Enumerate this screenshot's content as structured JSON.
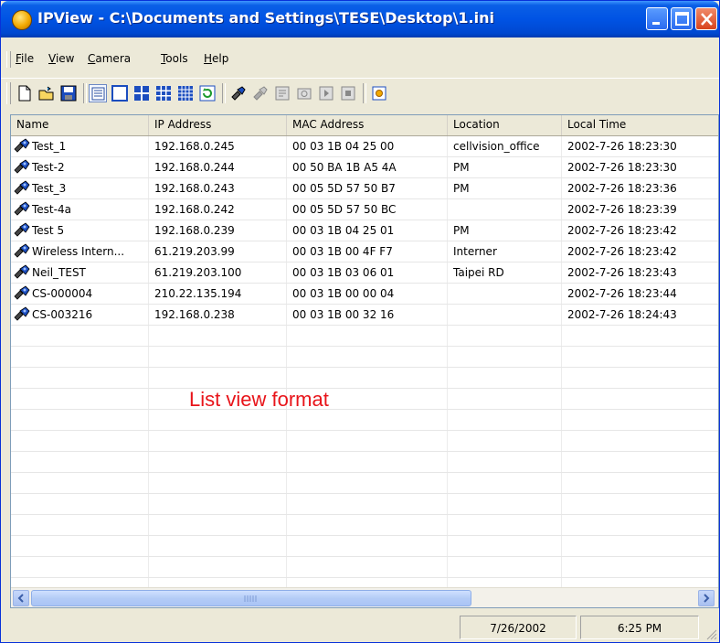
{
  "window": {
    "title": "IPView - C:\\Documents and Settings\\TESE\\Desktop\\1.ini",
    "title_color": "#0053e4"
  },
  "menu": {
    "items": [
      {
        "label": "File",
        "mnemonic": "F"
      },
      {
        "label": "View",
        "mnemonic": "V"
      },
      {
        "label": "Camera",
        "mnemonic": "C"
      },
      {
        "label": "Tools",
        "mnemonic": "T"
      },
      {
        "label": "Help",
        "mnemonic": "H"
      }
    ]
  },
  "toolbar": {
    "buttons": [
      "new-icon",
      "open-icon",
      "save-icon",
      "list-view-icon",
      "single-view-icon",
      "quad-view-icon",
      "nine-view-icon",
      "sixteen-view-icon",
      "refresh-icon",
      "connect-icon",
      "disconnect-icon",
      "properties-icon",
      "snapshot-icon",
      "play-icon",
      "stop-icon",
      "camera-settings-icon"
    ]
  },
  "list": {
    "columns": [
      "Name",
      "IP Address",
      "MAC Address",
      "Location",
      "Local Time"
    ],
    "rows": [
      {
        "name": "Test_1",
        "ip": "192.168.0.245",
        "mac": "00 03 1B 04 25 00",
        "location": "cellvision_office",
        "time": "2002-7-26  18:23:30"
      },
      {
        "name": "Test-2",
        "ip": "192.168.0.244",
        "mac": "00 50 BA 1B A5 4A",
        "location": "PM",
        "time": "2002-7-26  18:23:30"
      },
      {
        "name": "Test_3",
        "ip": "192.168.0.243",
        "mac": "00 05 5D 57 50 B7",
        "location": "PM",
        "time": "2002-7-26  18:23:36"
      },
      {
        "name": "Test-4a",
        "ip": "192.168.0.242",
        "mac": "00 05 5D 57 50 BC",
        "location": "",
        "time": "2002-7-26  18:23:39"
      },
      {
        "name": "Test 5",
        "ip": "192.168.0.239",
        "mac": "00 03 1B 04 25 01",
        "location": "PM",
        "time": "2002-7-26  18:23:42"
      },
      {
        "name": "Wireless Intern...",
        "ip": "61.219.203.99",
        "mac": "00 03 1B 00 4F F7",
        "location": "Interner",
        "time": "2002-7-26  18:23:42"
      },
      {
        "name": "Neil_TEST",
        "ip": "61.219.203.100",
        "mac": "00 03 1B 03 06 01",
        "location": "Taipei RD",
        "time": "2002-7-26  18:23:43"
      },
      {
        "name": "CS-000004",
        "ip": "210.22.135.194",
        "mac": "00 03 1B 00 00 04",
        "location": "",
        "time": "2002-7-26  18:23:44"
      },
      {
        "name": "CS-003216",
        "ip": "192.168.0.238",
        "mac": "00 03 1B 00 32 16",
        "location": "",
        "time": "2002-7-26  18:24:43"
      }
    ]
  },
  "annotation": {
    "label": "List view format",
    "color": "#e8141a"
  },
  "status": {
    "date": "7/26/2002",
    "time": "6:25 PM"
  }
}
